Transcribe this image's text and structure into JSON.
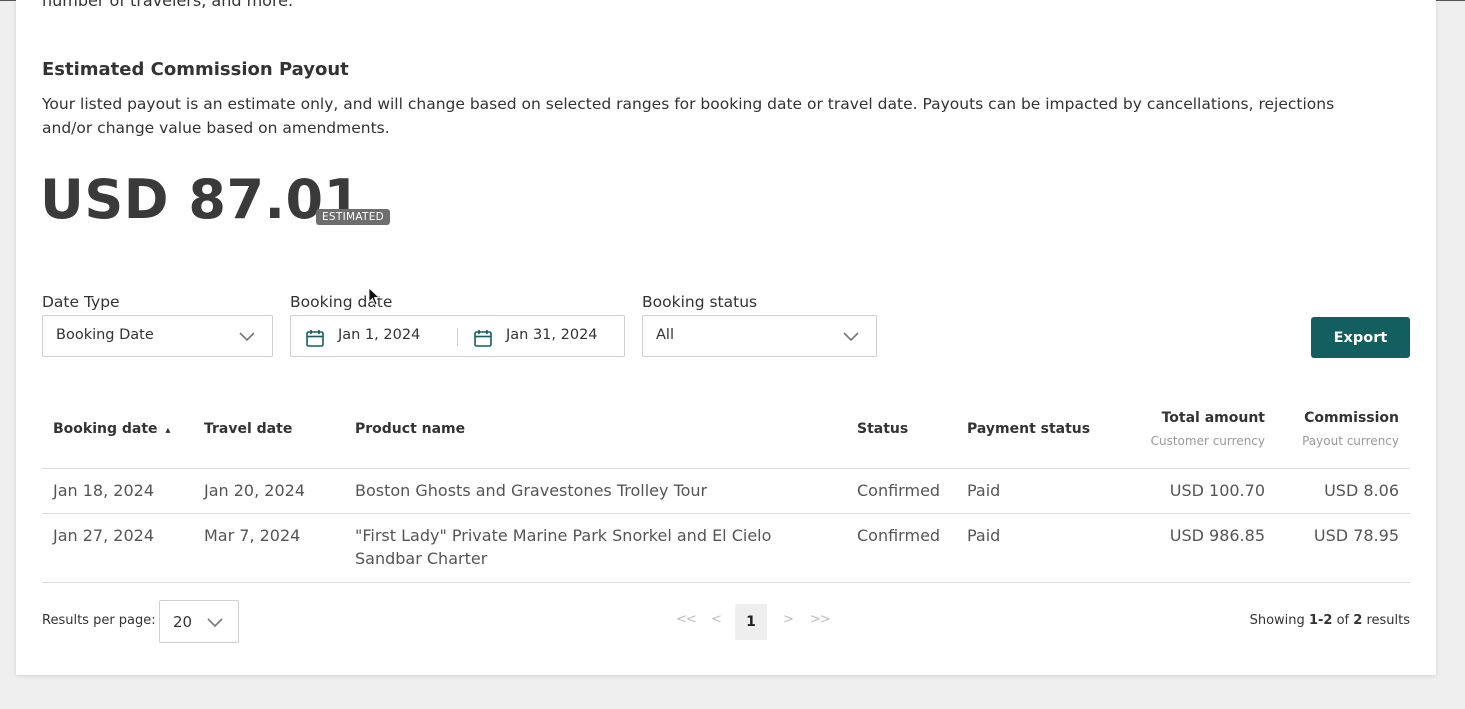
{
  "intro": {
    "tail_text": "number of travelers, and more."
  },
  "payout": {
    "title": "Estimated Commission Payout",
    "description": "Your listed payout is an estimate only, and will change based on selected ranges for booking date or travel date. Payouts can be impacted by cancellations, rejections and/or change value based on amendments.",
    "amount": "USD 87.01",
    "badge": "ESTIMATED"
  },
  "filters": {
    "date_type": {
      "label": "Date Type",
      "value": "Booking Date"
    },
    "booking_date": {
      "label": "Booking date",
      "start": "Jan 1, 2024",
      "end": "Jan 31, 2024"
    },
    "booking_status": {
      "label": "Booking status",
      "value": "All"
    },
    "export_label": "Export"
  },
  "table": {
    "headers": {
      "booking_date": "Booking date",
      "sort_indicator": "▴",
      "travel_date": "Travel date",
      "product_name": "Product name",
      "status": "Status",
      "payment_status": "Payment status",
      "total_amount": "Total amount",
      "total_amount_sub": "Customer currency",
      "commission": "Commission",
      "commission_sub": "Payout currency"
    },
    "rows": [
      {
        "booking_date": "Jan 18, 2024",
        "travel_date": "Jan 20, 2024",
        "product_name": "Boston Ghosts and Gravestones Trolley Tour",
        "status": "Confirmed",
        "payment_status": "Paid",
        "total_amount": "USD 100.70",
        "commission": "USD 8.06"
      },
      {
        "booking_date": "Jan 27, 2024",
        "travel_date": "Mar 7, 2024",
        "product_name": "\"First Lady\" Private Marine Park Snorkel and El Cielo Sandbar Charter",
        "status": "Confirmed",
        "payment_status": "Paid",
        "total_amount": "USD 986.85",
        "commission": "USD 78.95"
      }
    ]
  },
  "pagination": {
    "results_per_page_label": "Results per page:",
    "results_per_page": "20",
    "first": "<<",
    "prev": "<",
    "current_page": "1",
    "next": ">",
    "last": ">>",
    "showing_prefix": "Showing",
    "showing_range": "1-2",
    "showing_of": "of",
    "showing_total": "2",
    "showing_suffix": "results"
  },
  "colors": {
    "accent": "#135e5e",
    "badge": "#6e6e6e",
    "calendar_icon": "#135e5e"
  }
}
